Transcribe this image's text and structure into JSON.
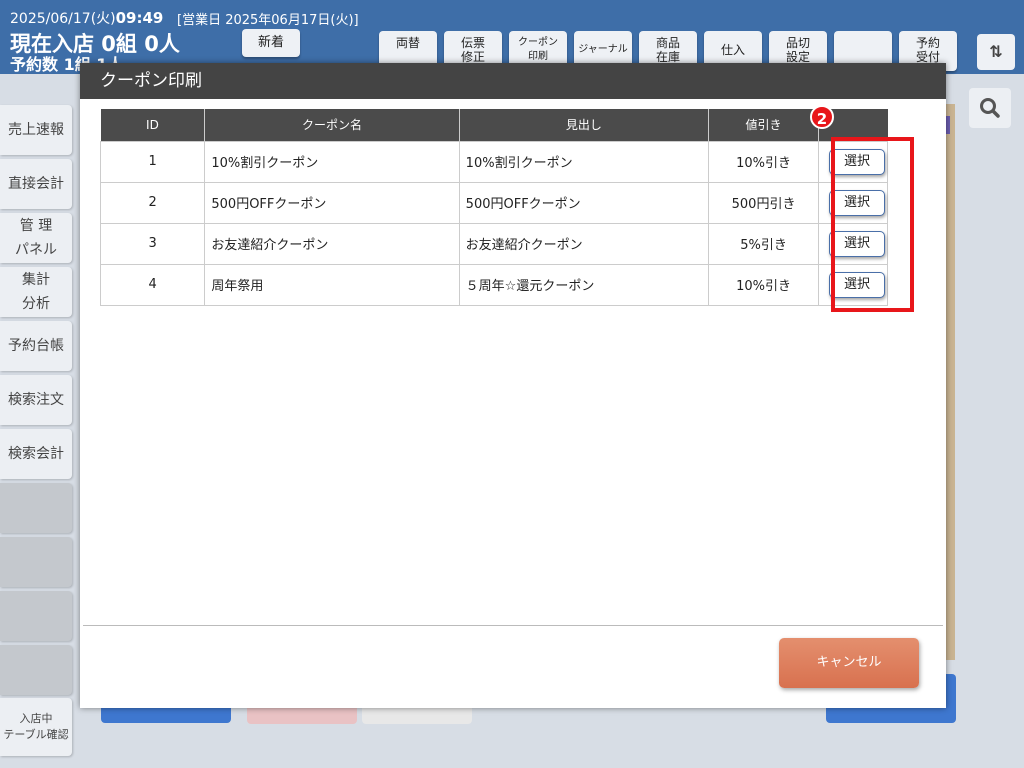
{
  "header": {
    "date": "2025/06/17(火)",
    "time": "09:49",
    "business_date": "[営業日 2025年06月17日(火)]",
    "current_guests": "現在入店 0組 0人",
    "reservations": "予約数 1組 1人",
    "new_button": "新着",
    "top_buttons": [
      {
        "label": "両替"
      },
      {
        "label": "伝票\n修正"
      },
      {
        "label": "クーポン\n印刷"
      },
      {
        "label": "ジャーナル"
      },
      {
        "label": "商品\n在庫"
      },
      {
        "label": "仕入"
      },
      {
        "label": "品切\n設定"
      },
      {
        "label": ""
      },
      {
        "label": "予約\n受付"
      }
    ],
    "sort_icon": "⇅"
  },
  "sidebar": {
    "items": [
      {
        "label": "売上速報"
      },
      {
        "label": "直接会計"
      },
      {
        "label": "管 理\nパネル"
      },
      {
        "label": "集計\n分析"
      },
      {
        "label": "予約台帳"
      },
      {
        "label": "検索注文"
      },
      {
        "label": "検索会計"
      },
      {
        "label": ""
      },
      {
        "label": ""
      },
      {
        "label": ""
      },
      {
        "label": ""
      },
      {
        "label": "入店中\nテーブル確認"
      }
    ]
  },
  "modal": {
    "title": "クーポン印刷",
    "columns": {
      "id": "ID",
      "name": "クーポン名",
      "heading": "見出し",
      "discount": "値引き"
    },
    "badge": "2",
    "rows": [
      {
        "id": "1",
        "name": "10%割引クーポン",
        "heading": "10%割引クーポン",
        "discount": "10%引き",
        "select": "選択"
      },
      {
        "id": "2",
        "name": "500円OFFクーポン",
        "heading": "500円OFFクーポン",
        "discount": "500円引き",
        "select": "選択"
      },
      {
        "id": "3",
        "name": "お友達紹介クーポン",
        "heading": "お友達紹介クーポン",
        "discount": "5%引き",
        "select": "選択"
      },
      {
        "id": "4",
        "name": "周年祭用",
        "heading": "５周年☆還元クーポン",
        "discount": "10%引き",
        "select": "選択"
      }
    ],
    "cancel": "キャンセル"
  },
  "colors": {
    "header_bg": "#3e6ea8",
    "highlight": "#e8161a",
    "cancel_button": "#d8714f"
  }
}
